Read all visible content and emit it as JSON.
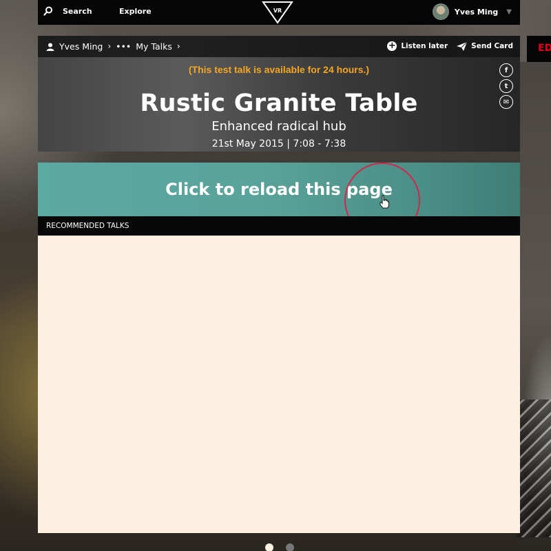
{
  "topbar": {
    "search_label": "Search",
    "search_icon": "search-icon",
    "explore_label": "Explore",
    "logo_text": "VR",
    "user_name": "Yves Ming",
    "caret": "▼"
  },
  "breadcrumb": {
    "user": "Yves Ming",
    "ellipsis": "•••",
    "section": "My Talks",
    "sep": "›"
  },
  "actions": {
    "listen_later": "Listen later",
    "send_card": "Send Card"
  },
  "talk": {
    "availability": "(This test talk is available for 24 hours.)",
    "title": "Rustic Granite Table",
    "subtitle": "Enhanced radical hub",
    "datetime": "21st May 2015 | 7:08 - 7:38"
  },
  "share": {
    "facebook": "f",
    "twitter": "t",
    "email": "✉"
  },
  "edge_tag": "ED",
  "reload": {
    "label": "Click to reload this page"
  },
  "recommended": {
    "heading": "RECOMMENDED TALKS"
  },
  "pagination": {
    "pages": 2,
    "active": 1
  },
  "colors": {
    "accent_orange": "#f5a623",
    "reload_teal": "#5aa39b",
    "panel_cream": "#fdf0e0",
    "edge_red": "#e4001b",
    "cursor_ring": "#d0284c"
  }
}
